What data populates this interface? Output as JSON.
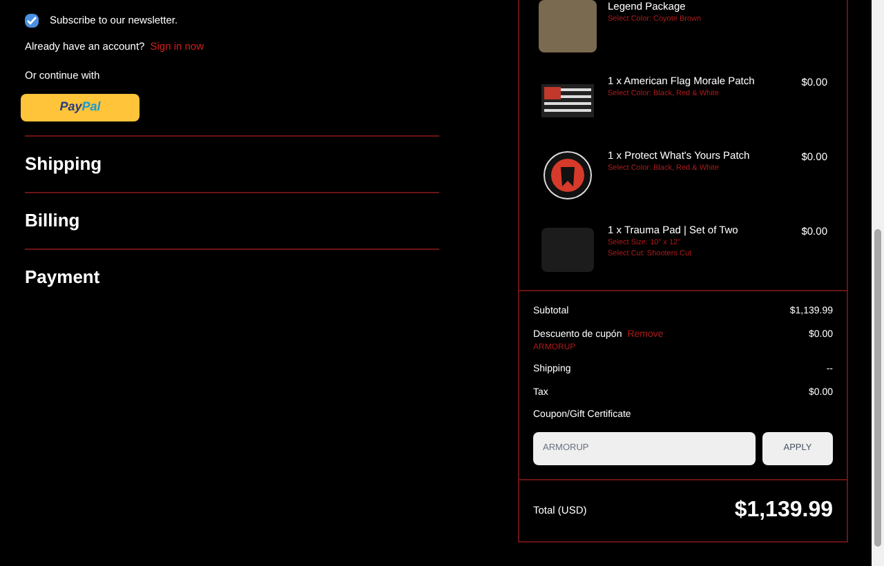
{
  "newsletter": {
    "label": "Subscribe to our newsletter.",
    "checked": true
  },
  "account": {
    "text": "Already have an account?",
    "link": "Sign in now"
  },
  "continue_label": "Or continue with",
  "paypal": {
    "label_a": "Pay",
    "label_b": "Pal"
  },
  "sections": [
    {
      "title": "Shipping"
    },
    {
      "title": "Billing"
    },
    {
      "title": "Payment"
    }
  ],
  "items": [
    {
      "title": "Legend Package",
      "options": [
        "Select Color: Coyote Brown"
      ],
      "kind": "vest"
    },
    {
      "title": "1 x American Flag Morale Patch",
      "price": "$0.00",
      "options": [
        "Select Color: Black, Red & White"
      ],
      "kind": "flag"
    },
    {
      "title": "1 x Protect What's Yours Patch",
      "price": "$0.00",
      "options": [
        "Select Color: Black, Red & White"
      ],
      "kind": "round"
    },
    {
      "title": "1 x Trauma Pad | Set of Two",
      "price": "$0.00",
      "options": [
        "Select Size: 10\" x 12\"",
        "Select Cut: Shooters Cut"
      ],
      "kind": "pad"
    }
  ],
  "summary": [
    {
      "label": "Subtotal",
      "value": "$1,139.99"
    },
    {
      "label": "Descuento de cupón",
      "link": "Remove",
      "code": "ARMORUP",
      "value": "$0.00"
    },
    {
      "label": "Shipping",
      "value": "--"
    },
    {
      "label": "Tax",
      "value": "$0.00"
    }
  ],
  "coupon": {
    "label": "Coupon/Gift Certificate",
    "placeholder": "ARMORUP",
    "button": "APPLY"
  },
  "total": {
    "label": "Total (USD)",
    "value": "$1,139.99"
  }
}
